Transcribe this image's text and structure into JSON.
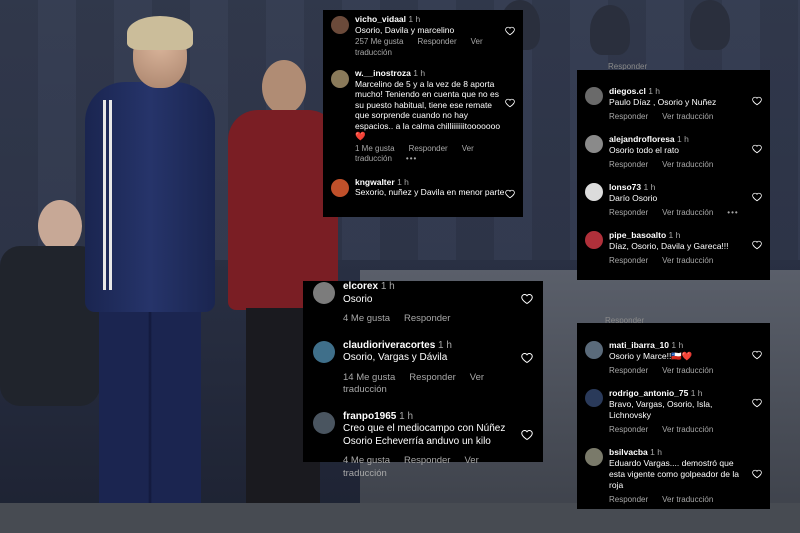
{
  "panel_top_center": {
    "comments": [
      {
        "user": "vicho_vidaal",
        "time": "1 h",
        "text": "Osorio, Davila y marcelino",
        "likes": "257 Me gusta",
        "reply": "Responder",
        "translate": "Ver traducción",
        "avatar_color": "#6b4a3a"
      },
      {
        "user": "w.__inostroza",
        "time": "1 h",
        "text": "Marcelino de 5 y a la vez de 8 aporta mucho! Teniendo en cuenta que no es su puesto habitual, tiene ese remate que sorprende cuando no hay espacios.. a la calma chilliiiiiiitooooooo❤️",
        "likes": "1 Me gusta",
        "reply": "Responder",
        "translate": "Ver traducción",
        "more": "•••",
        "avatar_color": "#8a7a5a"
      },
      {
        "user": "kngwalter",
        "time": "1 h",
        "text": "Sexorio, nuñez y Davila en menor parte",
        "avatar_color": "#c0502a"
      }
    ]
  },
  "panel_mid_center": {
    "comments": [
      {
        "user": "elcorex",
        "time": "1 h",
        "text": "Osorio",
        "likes": "4 Me gusta",
        "reply": "Responder",
        "avatar_color": "#7c7c7c"
      },
      {
        "user": "claudioriveracortes",
        "time": "1 h",
        "text": "Osorio, Vargas y Dávila",
        "likes": "14 Me gusta",
        "reply": "Responder",
        "translate": "Ver traducción",
        "avatar_color": "#3f6f8a"
      },
      {
        "user": "franpo1965",
        "time": "1 h",
        "text": "Creo que el mediocampo con Núñez Osorio Echeverría anduvo un kilo",
        "likes": "4 Me gusta",
        "reply": "Responder",
        "translate": "Ver traducción",
        "avatar_color": "#4a5560"
      }
    ]
  },
  "panel_top_right": {
    "partial_meta": "Responder",
    "comments": [
      {
        "user": "diegos.cl",
        "time": "1 h",
        "text": "Paulo Díaz , Osorio y Nuñez",
        "reply": "Responder",
        "translate": "Ver traducción",
        "avatar_color": "#6a6a6a"
      },
      {
        "user": "alejandrofloresa",
        "time": "1 h",
        "text": "Osorio todo el rato",
        "reply": "Responder",
        "translate": "Ver traducción",
        "avatar_color": "#8a8a8a"
      },
      {
        "user": "lonso73",
        "time": "1 h",
        "text": "Darío Osorio",
        "reply": "Responder",
        "translate": "Ver traducción",
        "more": "•••",
        "avatar_color": "#dcdcdc"
      },
      {
        "user": "pipe_basoalto",
        "time": "1 h",
        "text": "Díaz, Osorio, Davila y Gareca!!!",
        "reply": "Responder",
        "translate": "Ver traducción",
        "avatar_color": "#b0303a"
      }
    ]
  },
  "panel_bottom_right": {
    "caption": "Responder",
    "comments": [
      {
        "user": "mati_ibarra_10",
        "time": "1 h",
        "text": "Osorio y Marce!!🇨🇱❤️",
        "reply": "Responder",
        "translate": "Ver traducción",
        "avatar_color": "#5a6a7a"
      },
      {
        "user": "rodrigo_antonio_75",
        "time": "1 h",
        "text": "Bravo, Vargas, Osorio, Isla, Lichnovsky",
        "reply": "Responder",
        "translate": "Ver traducción",
        "avatar_color": "#2a3a5a"
      },
      {
        "user": "bsilvacba",
        "time": "1 h",
        "text": "Eduardo Vargas.... demostró que esta vigente como golpeador de la roja",
        "reply": "Responder",
        "translate": "Ver traducción",
        "avatar_color": "#7a7a6a"
      }
    ]
  },
  "icons": {
    "like": "heart-outline-icon",
    "more": "more-horizontal-icon"
  }
}
